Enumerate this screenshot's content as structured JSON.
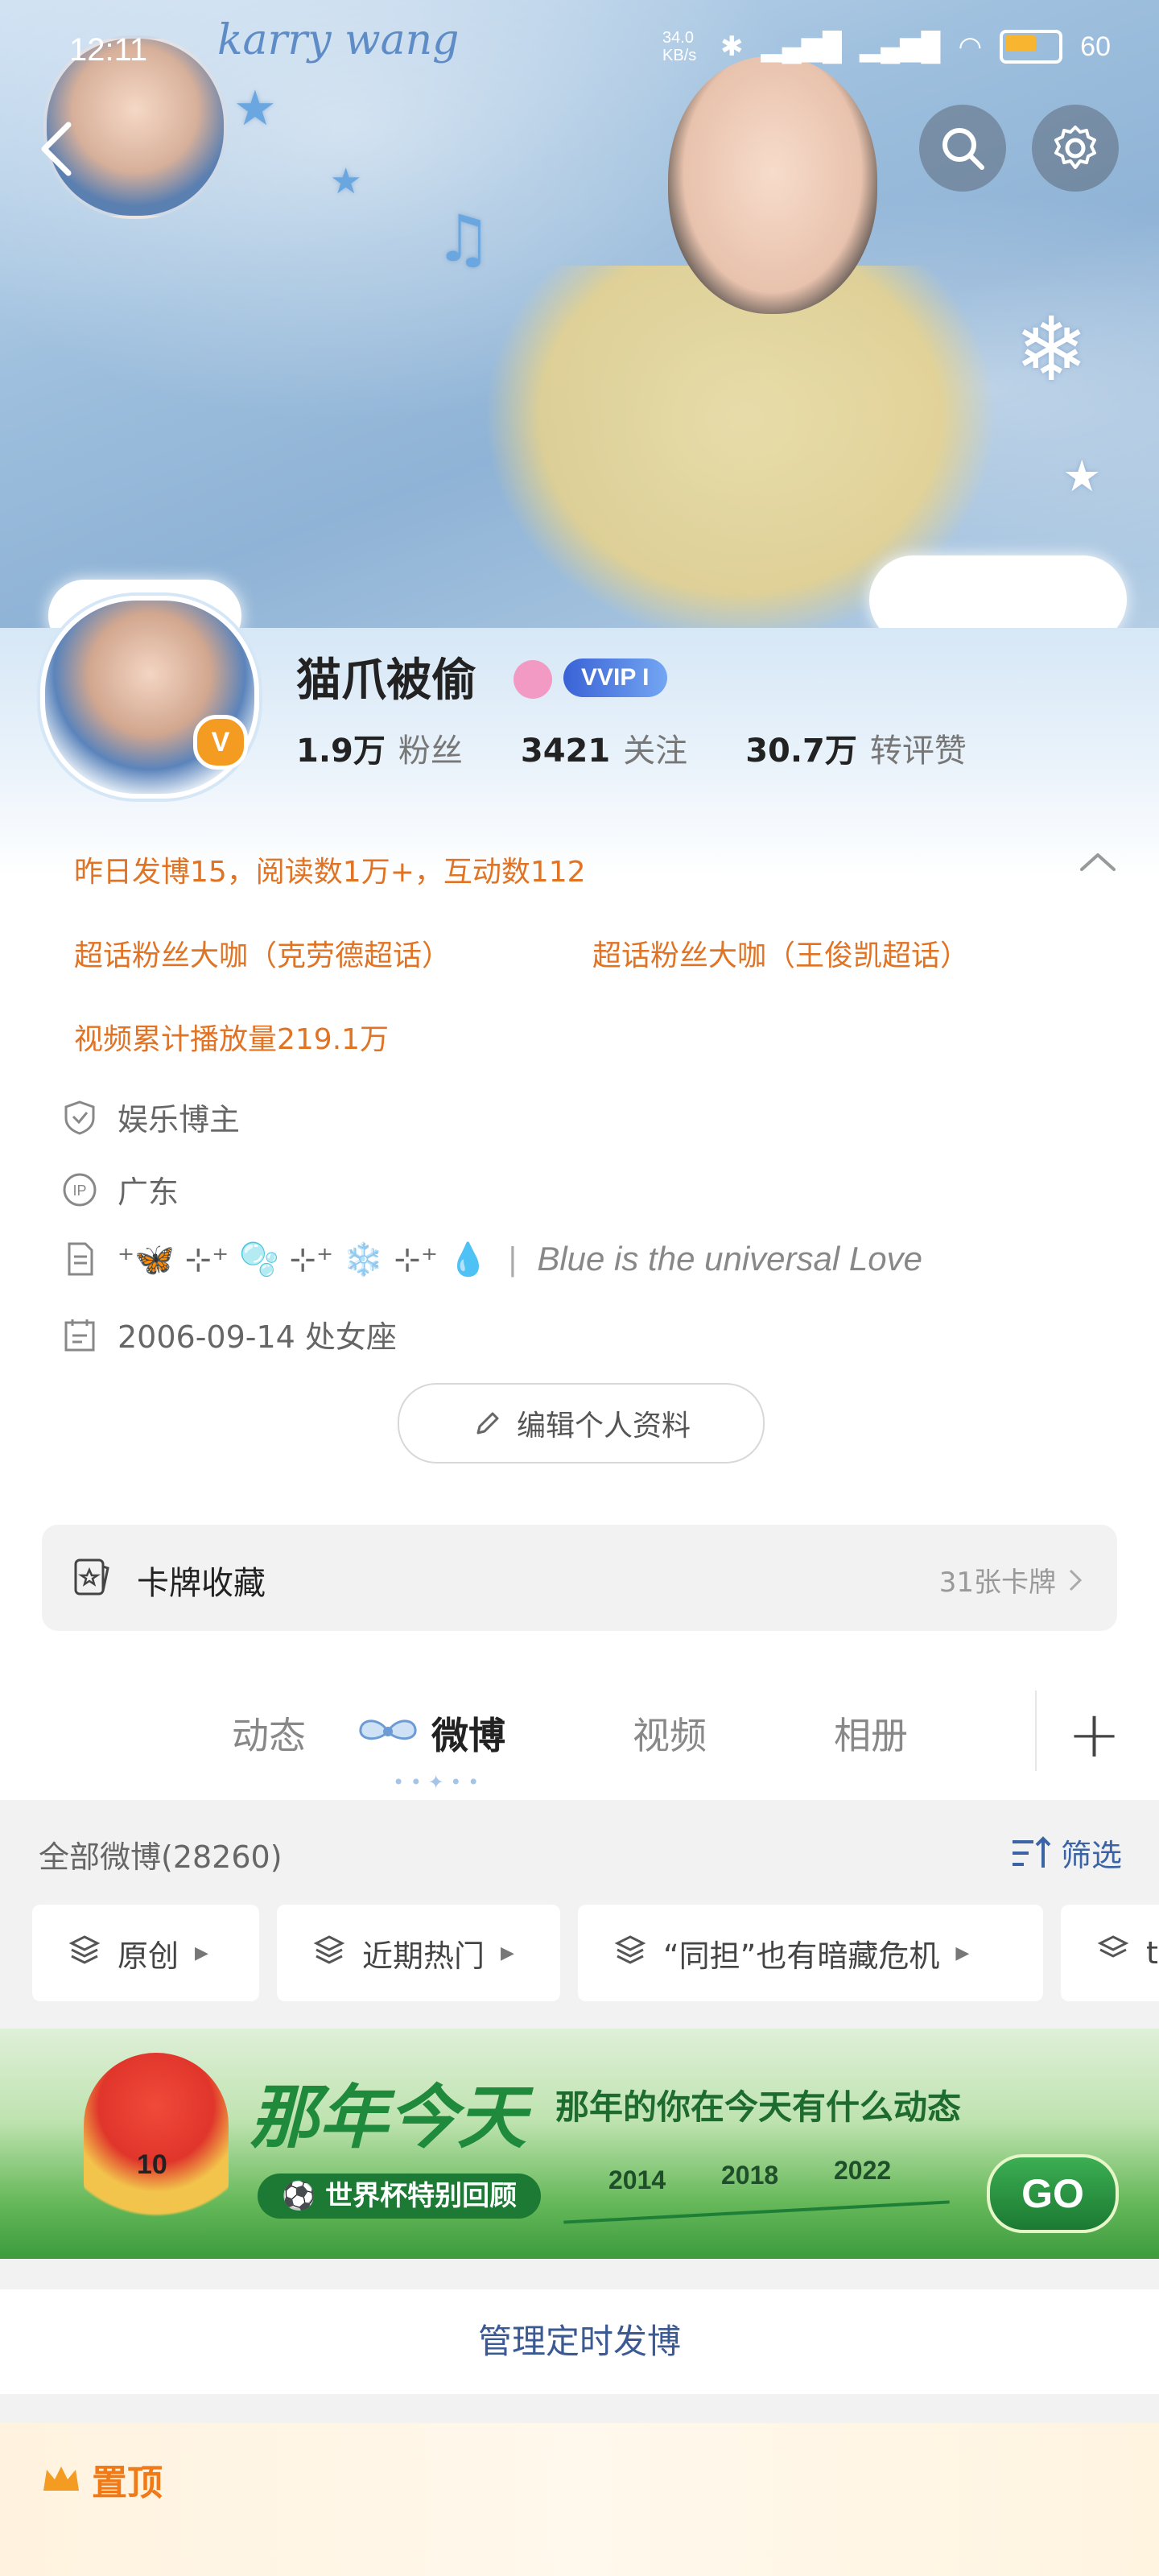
{
  "status": {
    "time": "12:11",
    "net_speed": "34.0 KB/s",
    "battery": "60"
  },
  "banner": {
    "watermark": "karry wang"
  },
  "profile": {
    "username": "猫爪被偷",
    "vip_badge": "VVIP I",
    "verified_badge": "V",
    "stats": [
      {
        "num": "1.9万",
        "label": "粉丝"
      },
      {
        "num": "3421",
        "label": "关注"
      },
      {
        "num": "30.7万",
        "label": "转评赞"
      }
    ]
  },
  "achievements": {
    "line1": "昨日发博15，阅读数1万+，互动数112",
    "line2a": "超话粉丝大咖（克劳德超话）",
    "line2b": "超话粉丝大咖（王俊凯超话）",
    "line3": "视频累计播放量219.1万"
  },
  "info": {
    "category": "娱乐博主",
    "ip": "广东",
    "ip_icon": "IP",
    "bio_text": "Blue is the universal Love",
    "bio_emojis": "⁺🦋 ⊹⁺ 🫧 ⊹⁺ ❄️ ⊹⁺ 💧",
    "birthday": "2006-09-14 处女座"
  },
  "edit_button": "编辑个人资料",
  "card_collection": {
    "title": "卡牌收藏",
    "count": "31张卡牌"
  },
  "tabs": [
    "动态",
    "微博",
    "视频",
    "相册"
  ],
  "active_tab": "微博",
  "weibo_header": {
    "all": "全部微博(28260)",
    "filter": "筛选"
  },
  "chips": [
    "原创",
    "近期热门",
    "“同担”也有暗藏危机",
    "t"
  ],
  "promo": {
    "title": "那年今天",
    "subtitle": "那年的你在今天有什么动态",
    "pill": "世界杯特别回顾",
    "years": [
      "2014",
      "2018",
      "2022"
    ],
    "go": "GO",
    "mascot_number": "10"
  },
  "manage_label": "管理定时发博",
  "pinned_label": "置顶",
  "colors": {
    "accent_orange": "#e07324",
    "link_blue": "#3b5a93",
    "vip_blue": "#3a62d6",
    "verified_orange": "#f49b22"
  }
}
